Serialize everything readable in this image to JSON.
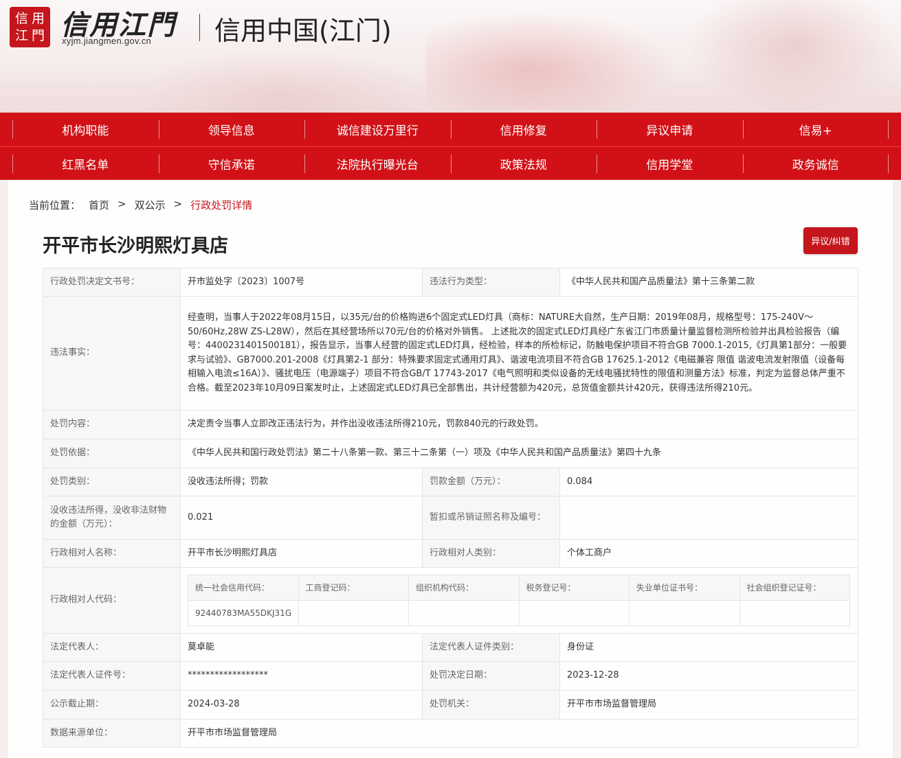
{
  "header": {
    "seal_chars": [
      "信",
      "用",
      "江",
      "門"
    ],
    "brand_name": "信用江門",
    "brand_url": "xyjm.jiangmen.gov.cn",
    "site_title": "信用中国(江门)"
  },
  "nav": {
    "row1": [
      "机构职能",
      "领导信息",
      "诚信建设万里行",
      "信用修复",
      "异议申请",
      "信易+"
    ],
    "row2": [
      "红黑名单",
      "守信承诺",
      "法院执行曝光台",
      "政策法规",
      "信用学堂",
      "政务诚信"
    ]
  },
  "breadcrumb": {
    "lead": "当前位置：",
    "items": [
      "首页",
      "双公示",
      "行政处罚详情"
    ],
    "separator": ">"
  },
  "company_title": "开平市长沙明熙灯具店",
  "objection_button": "异议/纠错",
  "detail": {
    "decision_no_label": "行政处罚决定文书号：",
    "decision_no": "开市监处字〔2023〕1007号",
    "violation_type_label": "违法行为类型：",
    "violation_type": "《中华人民共和国产品质量法》第十三条第二款",
    "facts_label": "违法事实：",
    "facts": "经查明，当事人于2022年08月15日，以35元/台的价格购进6个固定式LED灯具（商标：NATURE大自然，生产日期：2019年08月，规格型号：175-240V～50/60Hz,28W ZS-L28W），然后在其经营场所以70元/台的价格对外销售。 上述批次的固定式LED灯具经广东省江门市质量计量监督检测所检验并出具检验报告（编号：4400231401500181），报告显示，当事人经营的固定式LED灯具，经检验，样本的所检标记，防触电保护项目不符合GB 7000.1-2015,《灯具第1部分：一般要求与试验》、GB7000.201-2008《灯具第2-1 部分：特殊要求固定式通用灯具》、谐波电流项目不符合GB 17625.1-2012《电磁兼容 限值 谐波电流发射限值（设备每相输入电流≤16A）》、骚扰电压（电源端子）项目不符合GB/T 17743-2017《电气照明和类似设备的无线电骚扰特性的限值和测量方法》标准，判定为监督总体严重不合格。截至2023年10月09日案发时止，上述固定式LED灯具已全部售出，共计经营额为420元，总货值金额共计420元，获得违法所得210元。",
    "content_label": "处罚内容：",
    "content": "决定责令当事人立即改正违法行为，并作出没收违法所得210元，罚款840元的行政处罚。",
    "basis_label": "处罚依据：",
    "basis": "《中华人民共和国行政处罚法》第二十八条第一款、第三十二条第（一）项及《中华人民共和国产品质量法》第四十九条",
    "category_label": "处罚类别：",
    "category": "没收违法所得；罚款",
    "fine_label": "罚款金额（万元）：",
    "fine": "0.084",
    "confiscated_label": "没收违法所得，没收非法财物的金额（万元）：",
    "confiscated": "0.021",
    "license_label": "暂扣或吊销证照名称及编号：",
    "license": "",
    "party_name_label": "行政相对人名称：",
    "party_name": "开平市长沙明熙灯具店",
    "party_type_label": "行政相对人类别：",
    "party_type": "个体工商户",
    "party_code_label": "行政相对人代码：",
    "codes_headers": [
      "统一社会信用代码：",
      "工商登记码：",
      "组织机构代码：",
      "税务登记号：",
      "失业单位证书号：",
      "社会组织登记证号："
    ],
    "codes_values": [
      "92440783MA55DKJ31G",
      "",
      "",
      "",
      "",
      ""
    ],
    "legal_rep_label": "法定代表人：",
    "legal_rep": "莫卓能",
    "id_type_label": "法定代表人证件类别：",
    "id_type": "身份证",
    "id_no_label": "法定代表人证件号：",
    "id_no": "******************",
    "decision_date_label": "处罚决定日期：",
    "decision_date": "2023-12-28",
    "deadline_label": "公示截止期：",
    "deadline": "2024-03-28",
    "authority_label": "处罚机关：",
    "authority": "开平市市场监督管理局",
    "source_label": "数据来源单位：",
    "source": "开平市市场监督管理局"
  },
  "colors": {
    "brand_red": "#c4161c",
    "nav_red": "#d11117"
  }
}
